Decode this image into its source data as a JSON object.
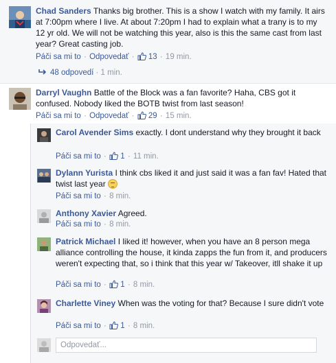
{
  "comments": [
    {
      "author": "Chad Sanders",
      "text": "Thanks big brother. This is a show I watch with my family. It airs at 7:00pm where I live. At about 7:20pm I had to explain what a trany is to my 12 yr old. We will not be watching this year, also is this the same cast from last year? Great casting job.",
      "like": "Páči sa mi to",
      "reply": "Odpovedať",
      "likes": "13",
      "time": "19 min."
    },
    {
      "author": "Darryl Vaughn",
      "text": "Battle of the Block was a fan favorite? Haha, CBS got it confused. Nobody liked the BOTB twist from last season!",
      "like": "Páči sa mi to",
      "reply": "Odpovedať",
      "likes": "29",
      "time": "15 min."
    }
  ],
  "replies_link": {
    "label": "48 odpovedí",
    "time": "1 min."
  },
  "replies": [
    {
      "author": "Carol Avender Sims",
      "text": "exactly. I dont understand why they brought it back",
      "like": "Páči sa mi to",
      "likes": "1",
      "time": "11 min."
    },
    {
      "author": "Dylann Yurista",
      "text": "I think cbs liked it and just said it was a fan fav! Hated that twist last year",
      "like": "Páči sa mi to",
      "likes": "",
      "time": "8 min."
    },
    {
      "author": "Anthony Xavier",
      "text": "Agreed.",
      "like": "Páči sa mi to",
      "likes": "",
      "time": "8 min."
    },
    {
      "author": "Patrick Michael",
      "text": "I liked it! however, when you have an 8 person mega alliance controlling the house, it kinda zapps the fun from it, and producers weren't expecting that, so i think that this year w/ Takeover, itll shake it up",
      "like": "Páči sa mi to",
      "likes": "1",
      "time": "8 min."
    },
    {
      "author": "Charlette Viney",
      "text": "When was the voting for that? Because I sure didn't vote",
      "like": "Páči sa mi to",
      "likes": "1",
      "time": "8 min."
    }
  ],
  "reply_input": {
    "placeholder": "Odpovedať..."
  },
  "icons": {
    "like": "thumbs-up-icon",
    "reply_arrow": "reply-arrow-icon",
    "emoji": "pensive-face-emoji"
  },
  "colors": {
    "link": "#3b5998",
    "muted": "#9197a3",
    "panel": "#f6f7f9"
  }
}
